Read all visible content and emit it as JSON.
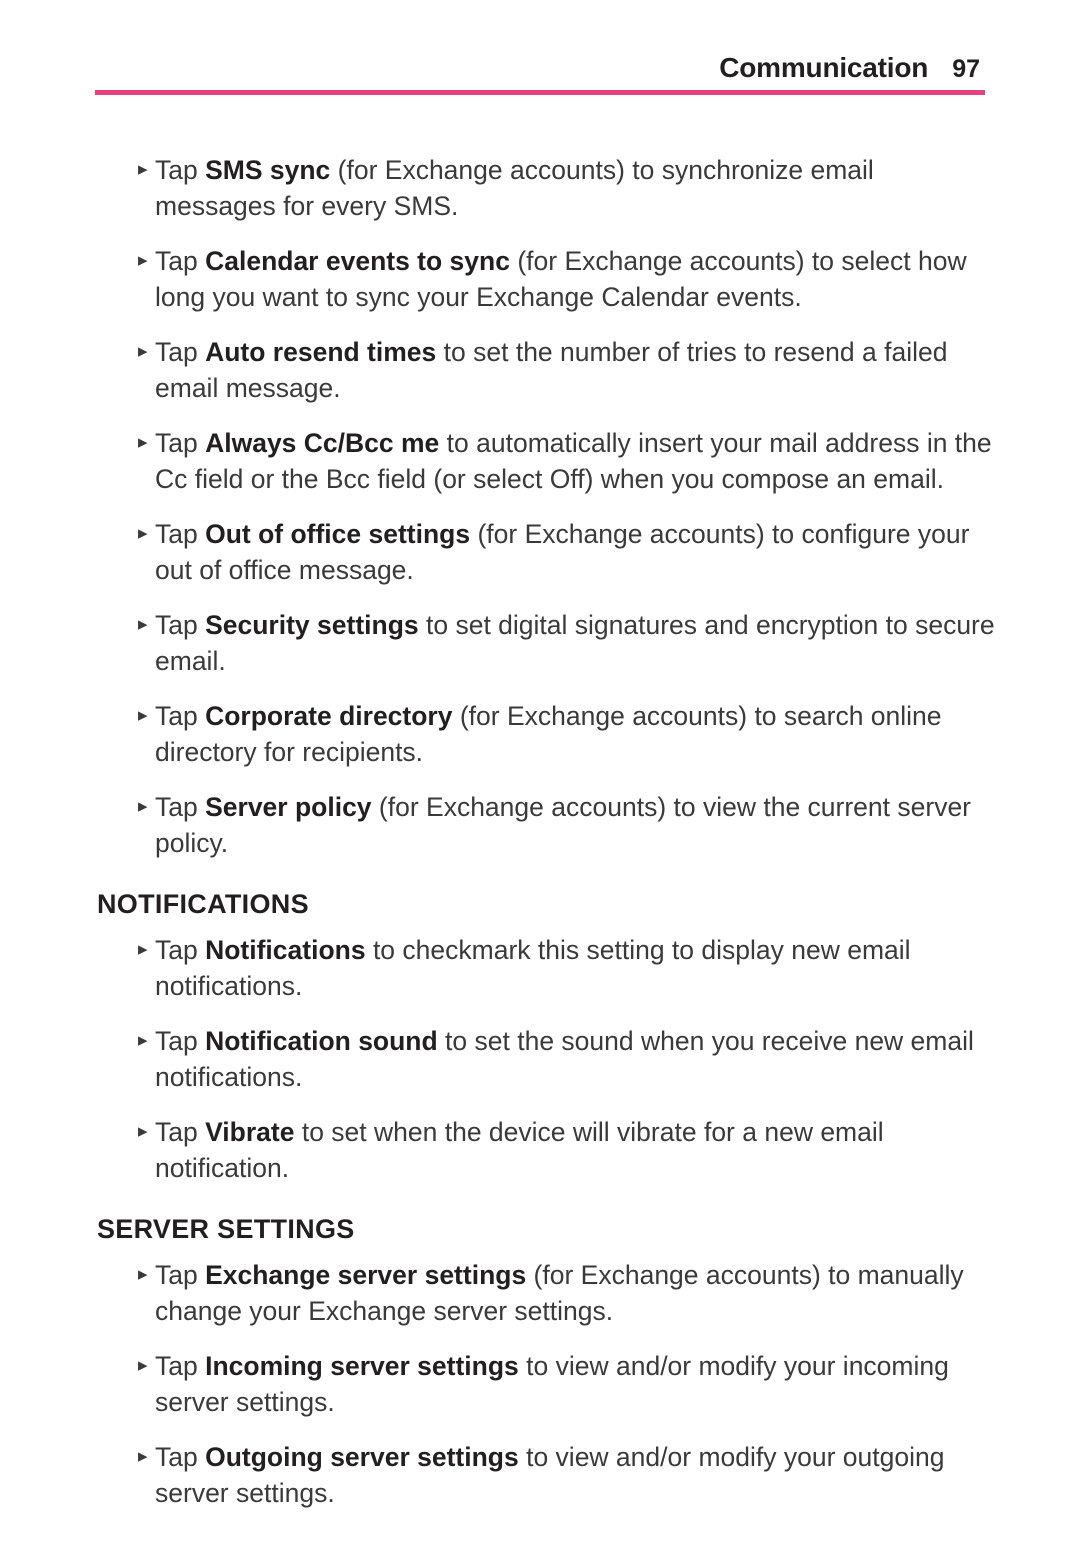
{
  "header": {
    "title": "Communication",
    "page_number": "97",
    "rule_color": "#e8417f"
  },
  "colors": {
    "accent": "#e8417f",
    "text": "#3a3a3a",
    "heading": "#231f20"
  },
  "bullet_glyph": "▸",
  "sections": [
    {
      "heading": null,
      "items": [
        {
          "lead": "Tap ",
          "term": "SMS sync",
          "rest": " (for Exchange accounts) to synchronize email messages for every SMS."
        },
        {
          "lead": "Tap ",
          "term": "Calendar events to sync",
          "rest": " (for Exchange accounts) to select how long you want to sync your Exchange Calendar events."
        },
        {
          "lead": "Tap ",
          "term": "Auto resend times",
          "rest": " to set the number of tries to resend a failed email message."
        },
        {
          "lead": "Tap ",
          "term": "Always Cc/Bcc me",
          "rest": " to automatically insert your mail address in the Cc field or the Bcc field (or select Off) when you compose an email."
        },
        {
          "lead": "Tap ",
          "term": "Out of office settings",
          "rest": " (for Exchange accounts) to configure your out of office message."
        },
        {
          "lead": "Tap ",
          "term": "Security settings",
          "rest": " to set digital signatures and encryption to secure email."
        },
        {
          "lead": "Tap ",
          "term": "Corporate directory",
          "rest": " (for Exchange accounts) to search online directory for recipients."
        },
        {
          "lead": "Tap ",
          "term": "Server policy",
          "rest": " (for Exchange accounts) to view the current server policy."
        }
      ]
    },
    {
      "heading": "NOTIFICATIONS",
      "items": [
        {
          "lead": "Tap ",
          "term": "Notifications",
          "rest": " to checkmark this setting to display new email notifications."
        },
        {
          "lead": "Tap ",
          "term": "Notification sound",
          "rest": " to set the sound when you receive new email notifications."
        },
        {
          "lead": "Tap ",
          "term": "Vibrate",
          "rest": " to set when the device will vibrate for a new email notification."
        }
      ]
    },
    {
      "heading": "SERVER SETTINGS",
      "items": [
        {
          "lead": "Tap ",
          "term": "Exchange server settings",
          "rest": " (for Exchange accounts) to manually change your Exchange server settings."
        },
        {
          "lead": "Tap ",
          "term": "Incoming server settings",
          "rest": " to view and/or modify your incoming server settings."
        },
        {
          "lead": "Tap ",
          "term": "Outgoing server settings",
          "rest": " to view and/or modify your outgoing server settings."
        }
      ]
    }
  ]
}
